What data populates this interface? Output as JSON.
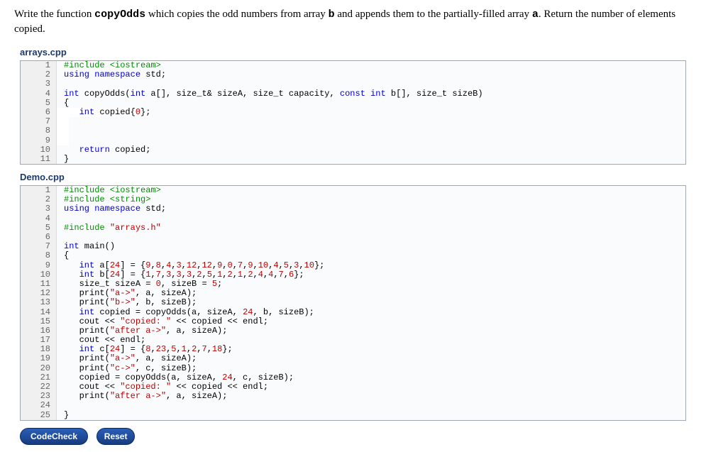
{
  "intro": {
    "prefix": "Write the function ",
    "fn": "copyOdds",
    "mid1": " which copies the odd numbers from array ",
    "b": "b",
    "mid2": " and appends them to the partially-filled array ",
    "a": "a",
    "tail": ". Return the number of elements copied."
  },
  "files": {
    "arrays": {
      "label": "arrays.cpp",
      "lines": [
        {
          "n": "1",
          "html": "<span class='pre'>#include &lt;iostream&gt;</span>"
        },
        {
          "n": "2",
          "html": "<span class='kw'>using</span> <span class='kw'>namespace</span> std;"
        },
        {
          "n": "3",
          "html": ""
        },
        {
          "n": "4",
          "html": "<span class='kw'>int</span> copyOdds(<span class='kw'>int</span> a[], size_t&amp; sizeA, size_t capacity, <span class='kw'>const</span> <span class='kw'>int</span> b[], size_t sizeB)"
        },
        {
          "n": "5",
          "html": "{"
        },
        {
          "n": "6",
          "html": "   <span class='kw'>int</span> copied{<span class='num'>0</span>};",
          "editable": true
        },
        {
          "n": "7",
          "html": "",
          "editable": true
        },
        {
          "n": "8",
          "html": "",
          "editable": true
        },
        {
          "n": "9",
          "html": "",
          "editable": true
        },
        {
          "n": "10",
          "html": "   <span class='kw'>return</span> copied;"
        },
        {
          "n": "11",
          "html": "}"
        }
      ]
    },
    "demo": {
      "label": "Demo.cpp",
      "lines": [
        {
          "n": "1",
          "html": "<span class='pre'>#include &lt;iostream&gt;</span>"
        },
        {
          "n": "2",
          "html": "<span class='pre'>#include &lt;string&gt;</span>"
        },
        {
          "n": "3",
          "html": "<span class='kw'>using</span> <span class='kw'>namespace</span> std;"
        },
        {
          "n": "4",
          "html": ""
        },
        {
          "n": "5",
          "html": "<span class='pre'>#include </span><span class='str'>\"arrays.h\"</span>"
        },
        {
          "n": "6",
          "html": ""
        },
        {
          "n": "7",
          "html": "<span class='kw'>int</span> main()"
        },
        {
          "n": "8",
          "html": "{"
        },
        {
          "n": "9",
          "html": "   <span class='kw'>int</span> a[<span class='num'>24</span>] = {<span class='num'>9</span>,<span class='num'>8</span>,<span class='num'>4</span>,<span class='num'>3</span>,<span class='num'>12</span>,<span class='num'>12</span>,<span class='num'>9</span>,<span class='num'>0</span>,<span class='num'>7</span>,<span class='num'>9</span>,<span class='num'>10</span>,<span class='num'>4</span>,<span class='num'>5</span>,<span class='num'>3</span>,<span class='num'>10</span>};"
        },
        {
          "n": "10",
          "html": "   <span class='kw'>int</span> b[<span class='num'>24</span>] = {<span class='num'>1</span>,<span class='num'>7</span>,<span class='num'>3</span>,<span class='num'>3</span>,<span class='num'>3</span>,<span class='num'>2</span>,<span class='num'>5</span>,<span class='num'>1</span>,<span class='num'>2</span>,<span class='num'>1</span>,<span class='num'>2</span>,<span class='num'>4</span>,<span class='num'>4</span>,<span class='num'>7</span>,<span class='num'>6</span>};"
        },
        {
          "n": "11",
          "html": "   size_t sizeA = <span class='num'>0</span>, sizeB = <span class='num'>5</span>;"
        },
        {
          "n": "12",
          "html": "   print(<span class='str'>\"a-&gt;\"</span>, a, sizeA);"
        },
        {
          "n": "13",
          "html": "   print(<span class='str'>\"b-&gt;\"</span>, b, sizeB);"
        },
        {
          "n": "14",
          "html": "   <span class='kw'>int</span> copied = copyOdds(a, sizeA, <span class='num'>24</span>, b, sizeB);"
        },
        {
          "n": "15",
          "html": "   cout &lt;&lt; <span class='str'>\"copied: \"</span> &lt;&lt; copied &lt;&lt; endl;"
        },
        {
          "n": "16",
          "html": "   print(<span class='str'>\"after a-&gt;\"</span>, a, sizeA);"
        },
        {
          "n": "17",
          "html": "   cout &lt;&lt; endl;"
        },
        {
          "n": "18",
          "html": "   <span class='kw'>int</span> c[<span class='num'>24</span>] = {<span class='num'>8</span>,<span class='num'>23</span>,<span class='num'>5</span>,<span class='num'>1</span>,<span class='num'>2</span>,<span class='num'>7</span>,<span class='num'>18</span>};"
        },
        {
          "n": "19",
          "html": "   print(<span class='str'>\"a-&gt;\"</span>, a, sizeA);"
        },
        {
          "n": "20",
          "html": "   print(<span class='str'>\"c-&gt;\"</span>, c, sizeB);"
        },
        {
          "n": "21",
          "html": "   copied = copyOdds(a, sizeA, <span class='num'>24</span>, c, sizeB);"
        },
        {
          "n": "22",
          "html": "   cout &lt;&lt; <span class='str'>\"copied: \"</span> &lt;&lt; copied &lt;&lt; endl;"
        },
        {
          "n": "23",
          "html": "   print(<span class='str'>\"after a-&gt;\"</span>, a, sizeA);"
        },
        {
          "n": "24",
          "html": ""
        },
        {
          "n": "25",
          "html": "}"
        }
      ]
    }
  },
  "buttons": {
    "codecheck": "CodeCheck",
    "reset": "Reset"
  }
}
